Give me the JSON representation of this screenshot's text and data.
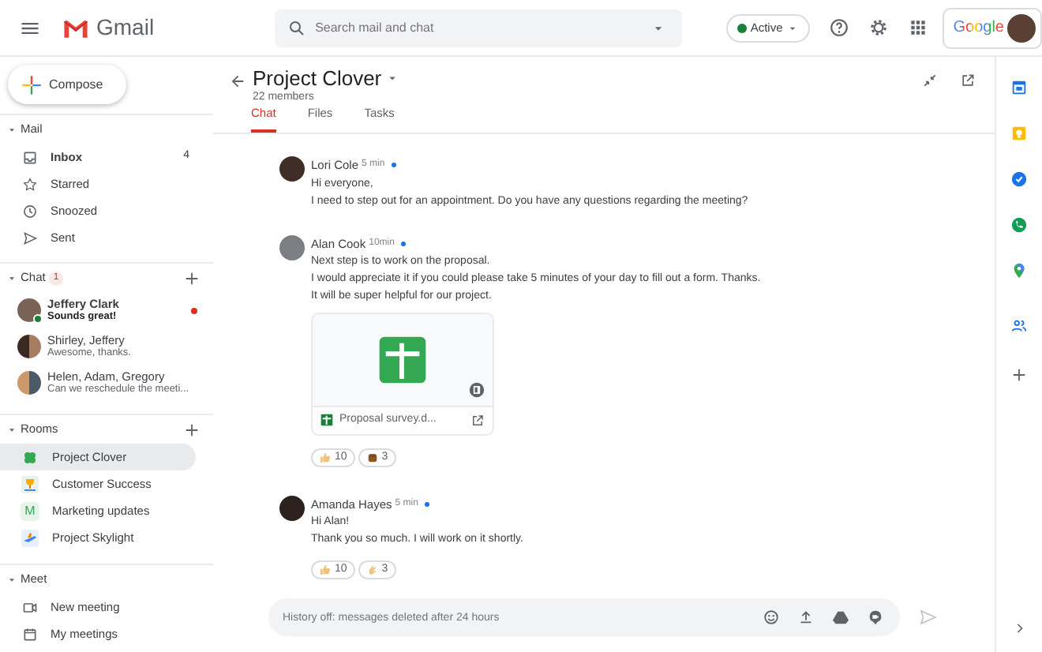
{
  "header": {
    "app_name": "Gmail",
    "search": {
      "placeholder": "Search mail and chat"
    },
    "status": {
      "label": "Active",
      "on": true
    },
    "account_brand": "Google"
  },
  "sidebar": {
    "compose": "Compose",
    "mail": {
      "title": "Mail",
      "expanded": true,
      "items": [
        {
          "label": "Inbox",
          "kind": "inbox",
          "count": "4",
          "unread": true
        },
        {
          "label": "Starred",
          "kind": "star",
          "unread": false
        },
        {
          "label": "Snoozed",
          "kind": "clock",
          "unread": false
        },
        {
          "label": "Sent",
          "kind": "send",
          "unread": false
        }
      ]
    },
    "chat": {
      "title": "Chat",
      "expanded": true,
      "badge": "1",
      "items": [
        {
          "name": "Jeffery Clark",
          "preview": "Sounds great!",
          "unread": true,
          "online": true,
          "kind": "single"
        },
        {
          "name": "Shirley, Jeffery",
          "preview": "Awesome, thanks.",
          "unread": false,
          "online": false,
          "kind": "pair"
        },
        {
          "name": "Helen, Adam, Gregory",
          "preview": "Can we reschedule the meeti...",
          "unread": false,
          "online": false,
          "kind": "group"
        }
      ]
    },
    "rooms": {
      "title": "Rooms",
      "expanded": true,
      "items": [
        {
          "label": "Project Clover",
          "kind": "clover",
          "selected": true
        },
        {
          "label": "Customer Success",
          "kind": "trophy",
          "selected": false
        },
        {
          "label": "Marketing updates",
          "kind": "initial",
          "initial": "M",
          "selected": false
        },
        {
          "label": "Project Skylight",
          "kind": "plane",
          "selected": false
        }
      ]
    },
    "meet": {
      "title": "Meet",
      "expanded": true,
      "items": [
        {
          "label": "New meeting",
          "kind": "video"
        },
        {
          "label": "My meetings",
          "kind": "calendar"
        }
      ]
    }
  },
  "conversation": {
    "title": "Project Clover",
    "members": "22 members",
    "tabs": [
      {
        "label": "Chat",
        "selected": true
      },
      {
        "label": "Files",
        "selected": false
      },
      {
        "label": "Tasks",
        "selected": false
      }
    ],
    "messages": [
      {
        "author": "Lori Cole",
        "time": "5 min",
        "online": true,
        "lines": [
          "Hi everyone,",
          "I need to step out for an appointment. Do you have any questions regarding the meeting?"
        ]
      },
      {
        "author": "Alan Cook",
        "time": "10min",
        "online": true,
        "lines": [
          "Next step is to work on the proposal.",
          "I would appreciate it if you could please take 5 minutes of your day to fill out a form. Thanks.",
          "It will be super helpful for our project."
        ],
        "attachment": {
          "name": "Proposal survey.d..."
        },
        "reactions": [
          {
            "kind": "thumbs",
            "count": "10"
          },
          {
            "kind": "fist",
            "count": "3"
          }
        ]
      },
      {
        "author": "Amanda Hayes",
        "time": "5 min",
        "online": true,
        "lines": [
          "Hi Alan!",
          "Thank you so much. I will work on it shortly."
        ],
        "reactions": [
          {
            "kind": "thumbs",
            "count": "10"
          },
          {
            "kind": "clap",
            "count": "3"
          }
        ]
      }
    ],
    "composer": {
      "placeholder": "History off: messages deleted after 24 hours"
    }
  }
}
